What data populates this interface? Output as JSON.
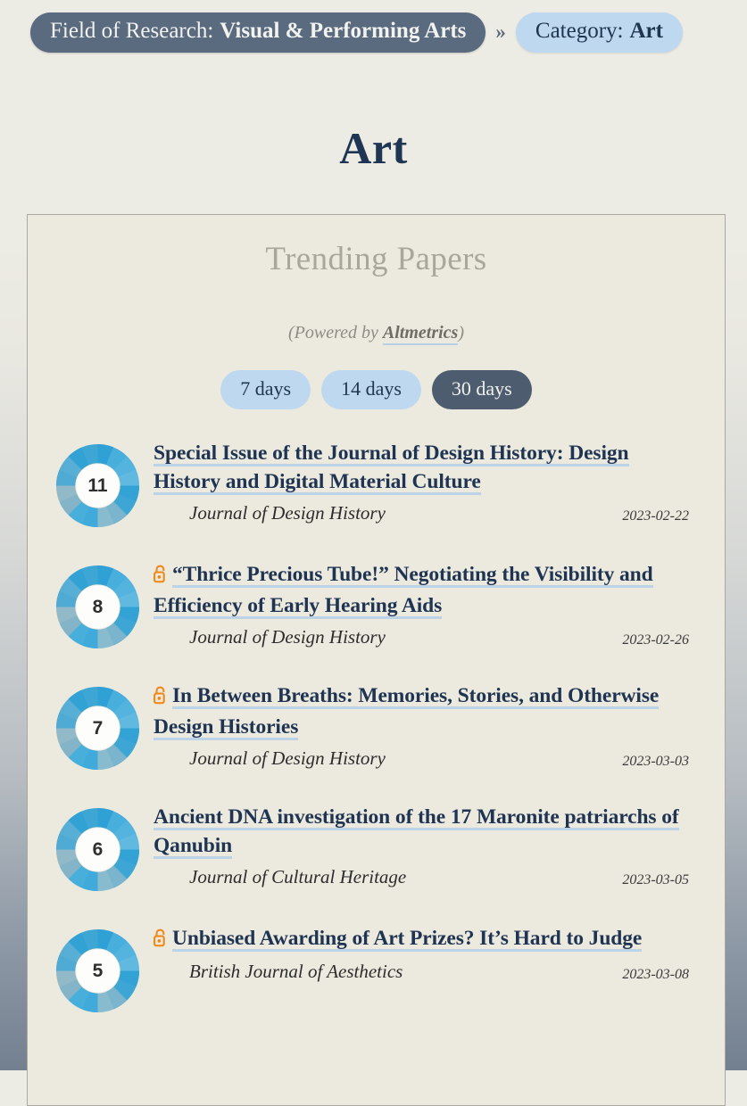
{
  "breadcrumb": {
    "field": {
      "label": "Field of Research:",
      "value": "Visual & Performing Arts"
    },
    "separator": "»",
    "category": {
      "label": "Category:",
      "value": "Art"
    }
  },
  "page_title": "Art",
  "card": {
    "heading": "Trending Papers",
    "powered_prefix": "(Powered by ",
    "powered_link": "Altmetrics",
    "powered_suffix": ")",
    "filters": [
      {
        "label": "7 days",
        "active": false
      },
      {
        "label": "14 days",
        "active": false
      },
      {
        "label": "30 days",
        "active": true
      }
    ]
  },
  "papers": [
    {
      "score": "11",
      "open_access": false,
      "title": "Special Issue of the Journal of Design History: Design History and Digital Material Culture",
      "journal": "Journal of Design History",
      "date": "2023-02-22"
    },
    {
      "score": "8",
      "open_access": true,
      "title": "“Thrice Precious Tube!” Negotiating the Visibility and Efficiency of Early Hearing Aids",
      "journal": "Journal of Design History",
      "date": "2023-02-26"
    },
    {
      "score": "7",
      "open_access": true,
      "title": "In Between Breaths: Memories, Stories, and Otherwise Design Histories",
      "journal": "Journal of Design History",
      "date": "2023-03-03"
    },
    {
      "score": "6",
      "open_access": false,
      "title": "Ancient DNA investigation of the 17 Maronite patriarchs of Qanubin",
      "journal": "Journal of Cultural Heritage",
      "date": "2023-03-05"
    },
    {
      "score": "5",
      "open_access": true,
      "title": "Unbiased Awarding of Art Prizes? It’s Hard to Judge",
      "journal": "British Journal of Aesthetics",
      "date": "2023-03-08"
    }
  ],
  "colors": {
    "page_bg_top": "#edece4",
    "page_bg_bottom": "#73808f",
    "card_bg": "#eceadf",
    "crumb_field_bg": "#5a6b80",
    "crumb_cat_bg": "#bdd8ef",
    "title_navy": "#1f3452",
    "pill_bg": "#bdd8ef",
    "pill_active_bg": "#4d5c6e",
    "underline_blue": "#bcd2e6",
    "open_access_orange": "#f08a1c",
    "donut_blue": "#3aa9db",
    "donut_blue_dark": "#6fa6bf"
  },
  "icons": {
    "open_access": "open-access-lock-icon",
    "altmetric_badge": "altmetric-donut-icon"
  }
}
